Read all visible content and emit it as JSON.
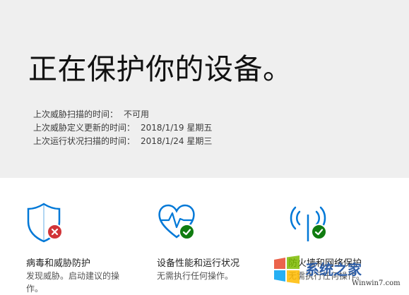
{
  "hero": {
    "title": "正在保护你的设备。",
    "background": "#efefef"
  },
  "status": [
    {
      "label": "上次威胁扫描的时间：",
      "value": "不可用"
    },
    {
      "label": "上次威胁定义更新的时间：",
      "value": "2018/1/19 星期五"
    },
    {
      "label": "上次运行状况扫描的时间：",
      "value": "2018/1/24 星期三"
    }
  ],
  "tiles": [
    {
      "title": "病毒和威胁防护",
      "description": "发现威胁。启动建议的操作。",
      "icon": "shield-icon",
      "badge": "error-x-badge",
      "badge_color": "#d13438"
    },
    {
      "title": "设备性能和运行状况",
      "description": "无需执行任何操作。",
      "icon": "heart-pulse-icon",
      "badge": "ok-check-badge",
      "badge_color": "#107c10"
    },
    {
      "title": "防火墙和网络保护",
      "description": "无需执行任何操作。",
      "icon": "antenna-icon",
      "badge": "ok-check-badge",
      "badge_color": "#107c10"
    }
  ],
  "colors": {
    "icon_accent": "#0078d7",
    "error": "#d13438",
    "ok": "#107c10"
  },
  "watermark": {
    "text": "系统之家",
    "url": "Winwin7.com"
  }
}
